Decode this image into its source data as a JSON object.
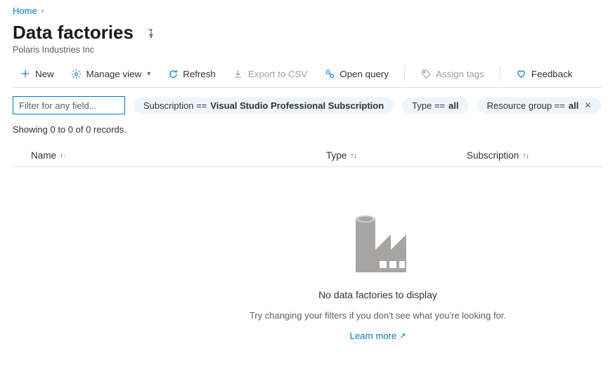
{
  "breadcrumb": {
    "home": "Home"
  },
  "page": {
    "title": "Data factories",
    "subtitle": "Polaris Industries Inc"
  },
  "toolbar": {
    "new": "New",
    "manage_view": "Manage view",
    "refresh": "Refresh",
    "export_csv": "Export to CSV",
    "open_query": "Open query",
    "assign_tags": "Assign tags",
    "feedback": "Feedback"
  },
  "filter": {
    "placeholder": "Filter for any field..."
  },
  "pills": [
    {
      "key": "Subscription == ",
      "value": "Visual Studio Professional Subscription",
      "closable": false
    },
    {
      "key": "Type == ",
      "value": "all",
      "closable": false
    },
    {
      "key": "Resource group == ",
      "value": "all",
      "closable": true
    }
  ],
  "results": {
    "count_text": "Showing 0 to 0 of 0 records."
  },
  "columns": {
    "name": "Name",
    "type": "Type",
    "subscription": "Subscription"
  },
  "empty": {
    "title": "No data factories to display",
    "subtitle": "Try changing your filters if you don't see what you're looking for.",
    "learn": "Learn more"
  }
}
